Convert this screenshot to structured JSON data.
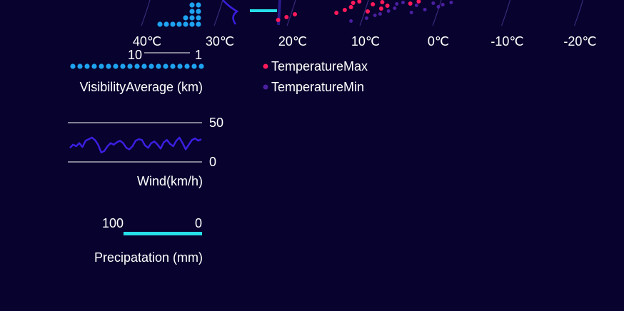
{
  "colors": {
    "background": "#07022e",
    "visibility_dots": "#1ea3f0",
    "wind_line": "#3a1fe0",
    "precip_bar": "#27dfe9",
    "temp_max": "#ff1a5b",
    "temp_min": "#4a1fa0",
    "ring": "#3a2a7a"
  },
  "chart_data": [
    {
      "type": "scatter",
      "name_key": "temperature",
      "axis_ticks": [
        "40℃",
        "30℃",
        "20℃",
        "10℃",
        "0℃",
        "-10℃",
        "-20℃"
      ],
      "axis_values": [
        40,
        30,
        20,
        10,
        0,
        -10,
        -20
      ],
      "series": [
        {
          "name": "TemperatureMax",
          "values": [
            22,
            21,
            20,
            14,
            13,
            12,
            12,
            11,
            10,
            9,
            8,
            8,
            7,
            4,
            3
          ]
        },
        {
          "name": "TemperatureMin",
          "values": [
            12,
            10,
            9,
            8,
            7,
            6,
            6,
            5,
            4,
            3,
            2,
            1,
            0,
            -1,
            -2
          ]
        }
      ]
    },
    {
      "type": "bar",
      "name_key": "visibility",
      "xlabel": "VisibilityAverage (km)",
      "scale_left": "10",
      "scale_right": "1",
      "dot_count": 19
    },
    {
      "type": "line",
      "name_key": "wind",
      "xlabel": "Wind(km/h)",
      "ylim": [
        0,
        50
      ],
      "tick_top": "50",
      "tick_bottom": "0",
      "values": [
        18,
        22,
        20,
        24,
        19,
        27,
        29,
        31,
        28,
        22,
        12,
        14,
        20,
        24,
        22,
        25,
        27,
        24,
        18,
        16,
        20,
        27,
        29,
        28,
        21,
        18,
        24,
        26,
        22,
        17,
        25,
        28,
        23,
        20,
        27,
        31,
        24,
        16,
        22,
        28,
        30,
        27,
        29
      ]
    },
    {
      "type": "bar",
      "name_key": "precipitation",
      "xlabel": "Precipatation (mm)",
      "scale_left": "100",
      "scale_right": "0",
      "value": 100
    }
  ]
}
